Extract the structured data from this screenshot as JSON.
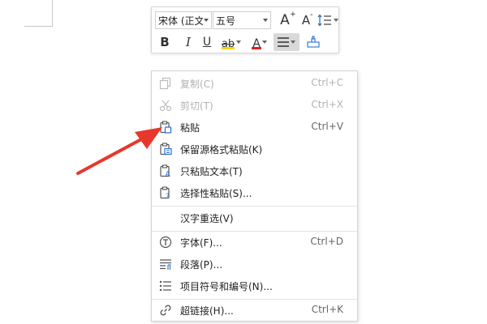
{
  "toolbar": {
    "font_name": "宋体 (正文",
    "font_size": "五号",
    "grow_font_label": "A",
    "shrink_font_label": "A",
    "bold_label": "B",
    "italic_label": "I",
    "underline_label": "U",
    "font_color_label": "A",
    "highlight_label": "ab",
    "highlight_color": "#ffd400",
    "font_color": "#e02020"
  },
  "menu": {
    "items": [
      {
        "label": "复制(C)",
        "shortcut": "Ctrl+C",
        "icon": "copy-icon",
        "enabled": false
      },
      {
        "label": "剪切(T)",
        "shortcut": "Ctrl+X",
        "icon": "scissors-icon",
        "enabled": false
      },
      {
        "label": "粘贴",
        "shortcut": "Ctrl+V",
        "icon": "paste-icon",
        "enabled": true
      },
      {
        "label": "保留源格式粘贴(K)",
        "shortcut": "",
        "icon": "paste-keep-format-icon",
        "enabled": true
      },
      {
        "label": "只粘贴文本(T)",
        "shortcut": "",
        "icon": "paste-text-only-icon",
        "enabled": true
      },
      {
        "label": "选择性粘贴(S)...",
        "shortcut": "",
        "icon": "paste-special-icon",
        "enabled": true
      },
      {
        "label": "汉字重选(V)",
        "shortcut": "",
        "icon": "",
        "enabled": true
      },
      {
        "label": "字体(F)...",
        "shortcut": "Ctrl+D",
        "icon": "font-icon",
        "enabled": true
      },
      {
        "label": "段落(P)...",
        "shortcut": "",
        "icon": "paragraph-icon",
        "enabled": true
      },
      {
        "label": "项目符号和编号(N)...",
        "shortcut": "",
        "icon": "bullets-icon",
        "enabled": true
      },
      {
        "label": "超链接(H)...",
        "shortcut": "Ctrl+K",
        "icon": "link-icon",
        "enabled": true
      }
    ]
  },
  "annotation_color": "#e8372c"
}
